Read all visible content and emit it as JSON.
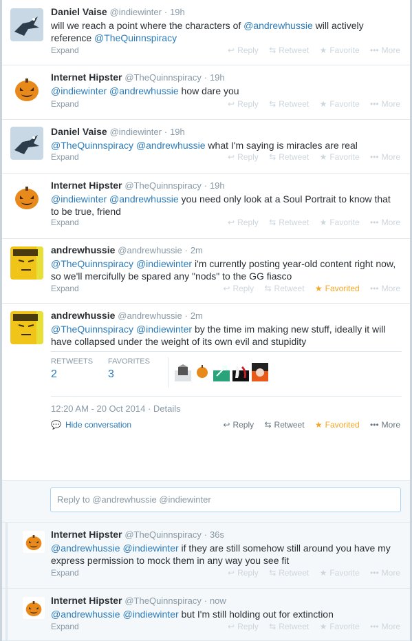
{
  "tweets": [
    {
      "name": "Daniel Vaise",
      "handle": "@indiewinter",
      "time": "19h",
      "text_parts": [
        {
          "t": "will we reach a point where the characters of "
        },
        {
          "t": "@andrewhussie",
          "m": true
        },
        {
          "t": " will actively reference "
        },
        {
          "t": "@TheQuinnspiracy",
          "m": true
        }
      ],
      "expand": "Expand",
      "avatar": "crow"
    },
    {
      "name": "Internet Hipster",
      "handle": "@TheQuinnspiracy",
      "time": "19h",
      "text_parts": [
        {
          "t": "@indiewinter",
          "m": true
        },
        {
          "t": " "
        },
        {
          "t": "@andrewhussie",
          "m": true
        },
        {
          "t": " how dare you"
        }
      ],
      "expand": "Expand",
      "avatar": "pumpkin"
    },
    {
      "name": "Daniel Vaise",
      "handle": "@indiewinter",
      "time": "19h",
      "text_parts": [
        {
          "t": "@TheQuinnspiracy",
          "m": true
        },
        {
          "t": " "
        },
        {
          "t": "@andrewhussie",
          "m": true
        },
        {
          "t": " what I'm saying is miracles are real"
        }
      ],
      "expand": "Expand",
      "avatar": "crow"
    },
    {
      "name": "Internet Hipster",
      "handle": "@TheQuinnspiracy",
      "time": "19h",
      "text_parts": [
        {
          "t": "@indiewinter",
          "m": true
        },
        {
          "t": " "
        },
        {
          "t": "@andrewhussie",
          "m": true
        },
        {
          "t": " you need only look at a Soul Portrait to know that to be true, friend"
        }
      ],
      "expand": "Expand",
      "avatar": "pumpkin"
    },
    {
      "name": "andrewhussie",
      "handle": "@andrewhussie",
      "time": "2m",
      "text_parts": [
        {
          "t": "@TheQuinnspiracy",
          "m": true
        },
        {
          "t": " "
        },
        {
          "t": "@indiewinter",
          "m": true
        },
        {
          "t": " i'm currently posting year-old content right now, so we'll mercifully be spared any \"nods\" to the GG fiasco"
        }
      ],
      "expand": "Expand",
      "avatar": "face",
      "favorited": true
    },
    {
      "name": "andrewhussie",
      "handle": "@andrewhussie",
      "time": "2m",
      "text_parts": [
        {
          "t": "@TheQuinnspiracy",
          "m": true
        },
        {
          "t": " "
        },
        {
          "t": "@indiewinter",
          "m": true
        },
        {
          "t": " by the time im making new stuff, ideally it will have collapsed under the weight of its own evil and stupidity"
        }
      ],
      "avatar": "face"
    },
    {
      "name": "Internet Hipster",
      "handle": "@TheQuinnspiracy",
      "time": "36s",
      "text_parts": [
        {
          "t": "@andrewhussie",
          "m": true
        },
        {
          "t": " "
        },
        {
          "t": "@indiewinter",
          "m": true
        },
        {
          "t": " if they are still somehow still around you have my express permission to mock them in any way you see fit"
        }
      ],
      "expand": "Expand",
      "avatar": "pumpkin"
    },
    {
      "name": "Internet Hipster",
      "handle": "@TheQuinnspiracy",
      "time": "now",
      "text_parts": [
        {
          "t": "@andrewhussie",
          "m": true
        },
        {
          "t": " "
        },
        {
          "t": "@indiewinter",
          "m": true
        },
        {
          "t": " but I'm still holding out for extinction"
        }
      ],
      "expand": "Expand",
      "avatar": "pumpkin"
    }
  ],
  "actions": {
    "reply": "Reply",
    "retweet": "Retweet",
    "favorite": "Favorite",
    "favorited": "Favorited",
    "more": "More"
  },
  "detail": {
    "retweets_label": "RETWEETS",
    "retweets": "2",
    "favorites_label": "FAVORITES",
    "favorites": "3",
    "timestamp": "12:20 AM - 20 Oct 2014",
    "separator": "·",
    "details_link": "Details",
    "hide_conversation": "Hide conversation"
  },
  "reply_box": {
    "text": "Reply to @andrewhussie @indiewinter"
  },
  "colors": {
    "link": "#2b7bb9",
    "favorited": "#f5a623",
    "muted": "#8899a6"
  }
}
